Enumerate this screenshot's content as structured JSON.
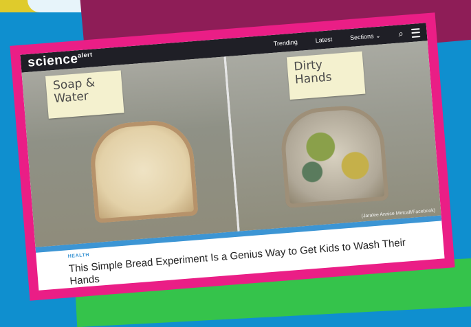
{
  "site": {
    "logo": "science",
    "logo_suffix": "alert",
    "nav": {
      "trending": "Trending",
      "latest": "Latest",
      "sections": "Sections"
    }
  },
  "photo": {
    "left_note": "Soap &\nWater",
    "right_note": "Dirty\nHands",
    "credit": "(Jaralee Annice Metcalf/Facebook)"
  },
  "article": {
    "category": "HEALTH",
    "headline": "This Simple Bread Experiment Is a Genius Way to Get Kids to Wash Their Hands"
  },
  "icons": {
    "search": "search-icon",
    "menu": "menu-icon",
    "chevron": "chevron-down-icon"
  },
  "colors": {
    "frame": "#ea1e86",
    "background": "#0f8fcf",
    "accent": "#3c95d4",
    "nav": "#1f1f26"
  }
}
